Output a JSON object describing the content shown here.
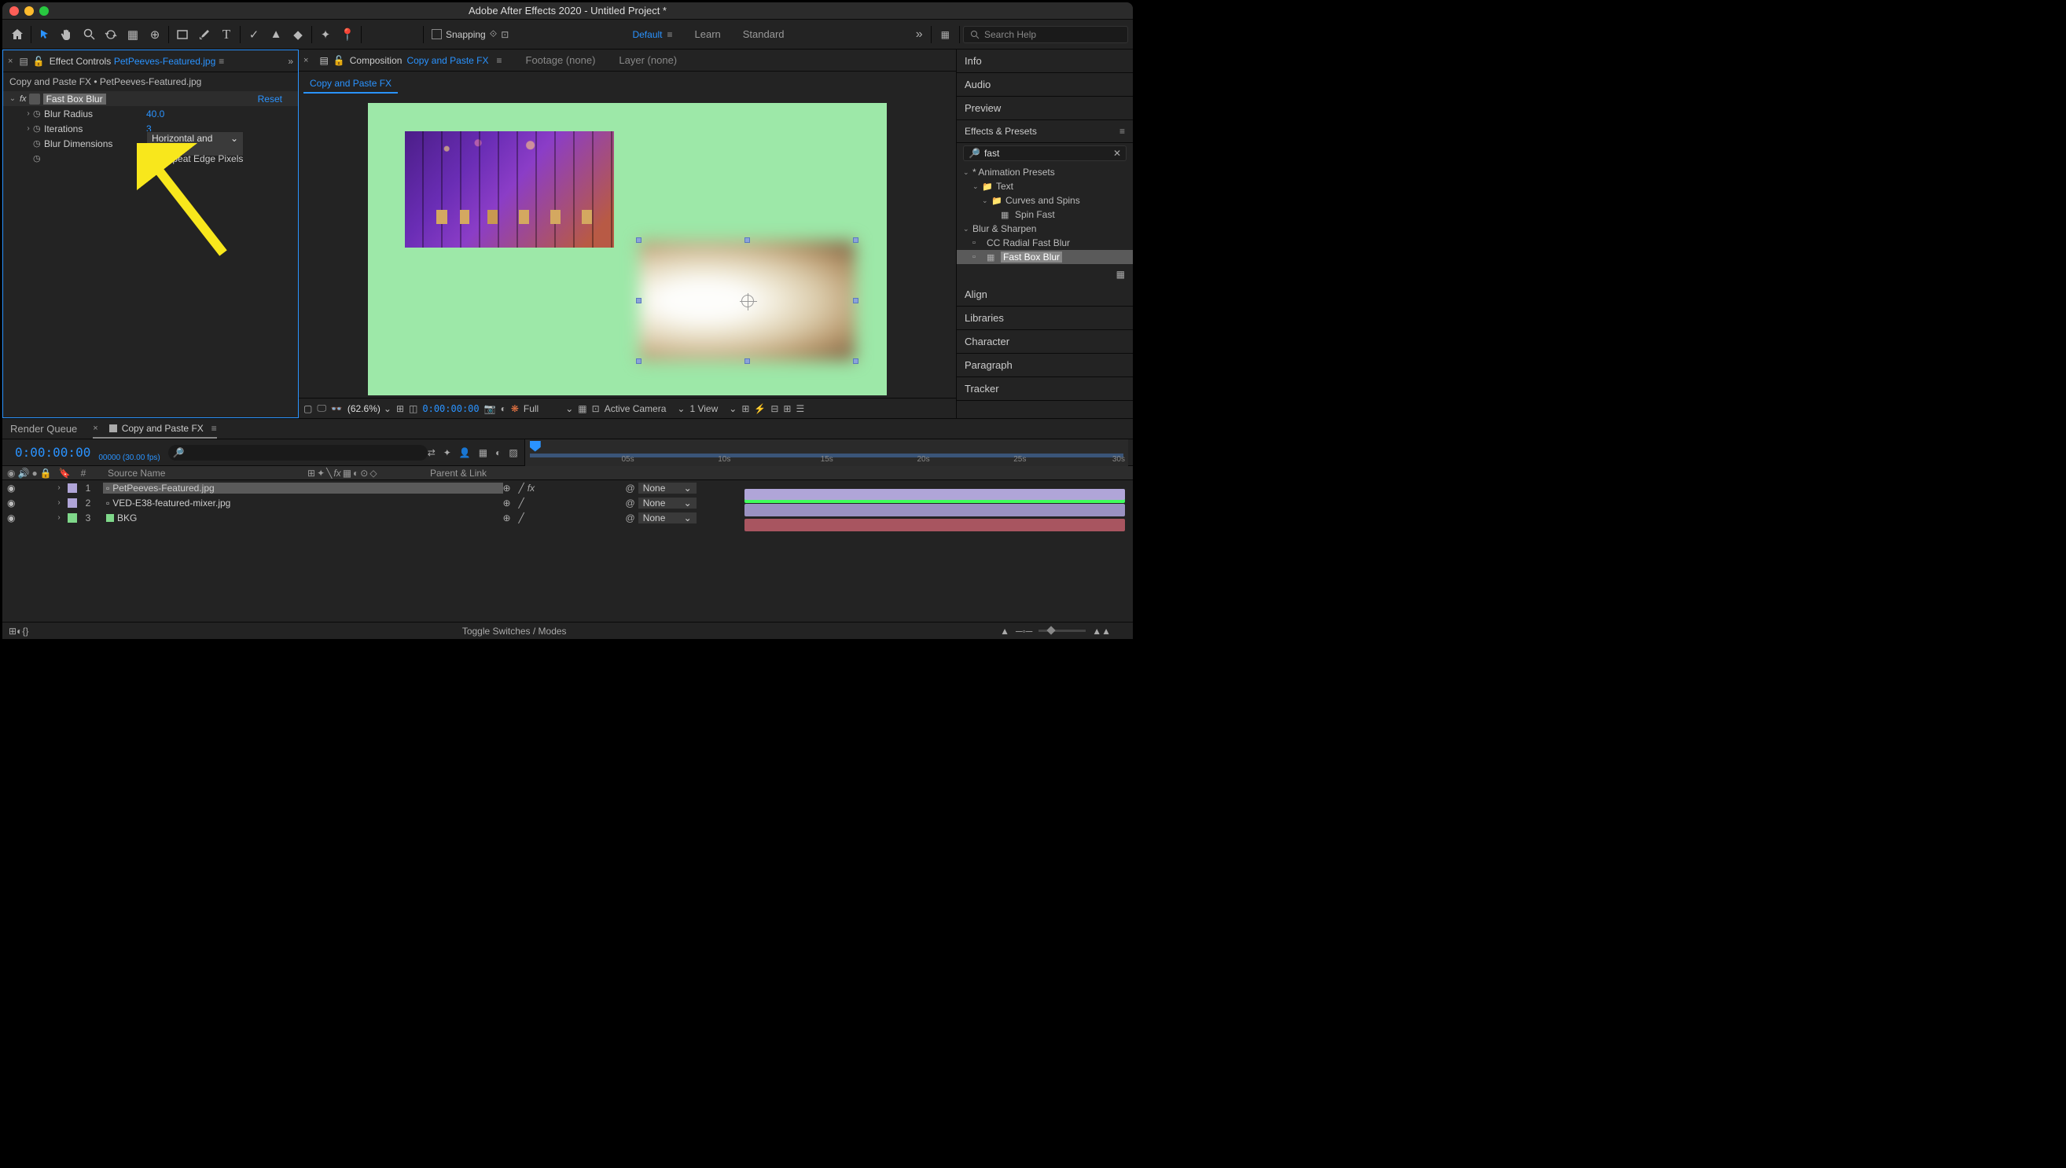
{
  "title": "Adobe After Effects 2020 - Untitled Project *",
  "toolbar": {
    "snapping": "Snapping",
    "workspaces": [
      "Default",
      "Learn",
      "Standard"
    ],
    "active_ws": 0,
    "search_ph": "Search Help"
  },
  "ec": {
    "tab": "Effect Controls",
    "file": "PetPeeves-Featured.jpg",
    "breadcrumb": "Copy and Paste FX • PetPeeves-Featured.jpg",
    "fx_name": "Fast Box Blur",
    "reset": "Reset",
    "params": {
      "blur_radius": {
        "label": "Blur Radius",
        "value": "40.0"
      },
      "iterations": {
        "label": "Iterations",
        "value": "3"
      },
      "dimensions": {
        "label": "Blur Dimensions",
        "value": "Horizontal and Verti"
      },
      "repeat": {
        "label": "Repeat Edge Pixels"
      }
    }
  },
  "comp": {
    "tab": "Composition",
    "name": "Copy and Paste FX",
    "footage": "Footage (none)",
    "layer": "Layer (none)",
    "bar": {
      "mag": "(62.6%)",
      "tc": "0:00:00:00",
      "full": "Full",
      "camera": "Active Camera",
      "view": "1 View"
    }
  },
  "rpanels": {
    "info": "Info",
    "audio": "Audio",
    "preview": "Preview",
    "ep": "Effects & Presets",
    "search": "fast",
    "tree": {
      "ap": "* Animation Presets",
      "text": "Text",
      "curves": "Curves and Spins",
      "spin": "Spin Fast",
      "bs": "Blur & Sharpen",
      "cc": "CC Radial Fast Blur",
      "fbb": "Fast Box Blur"
    },
    "align": "Align",
    "libraries": "Libraries",
    "character": "Character",
    "paragraph": "Paragraph",
    "tracker": "Tracker"
  },
  "tl": {
    "rq": "Render Queue",
    "comp": "Copy and Paste FX",
    "tc": "0:00:00:00",
    "fps": "00000 (30.00 fps)",
    "cols": {
      "source": "Source Name",
      "parent": "Parent & Link"
    },
    "layers": [
      {
        "n": "1",
        "name": "PetPeeves-Featured.jpg",
        "color": "lav",
        "sel": true,
        "parent": "None"
      },
      {
        "n": "2",
        "name": "VED-E38-featured-mixer.jpg",
        "color": "lav",
        "sel": false,
        "parent": "None"
      },
      {
        "n": "3",
        "name": "BKG",
        "color": "grn",
        "sel": false,
        "parent": "None"
      }
    ],
    "ticks": [
      "05s",
      "10s",
      "15s",
      "20s",
      "25s",
      "30s"
    ],
    "toggle": "Toggle Switches / Modes"
  }
}
